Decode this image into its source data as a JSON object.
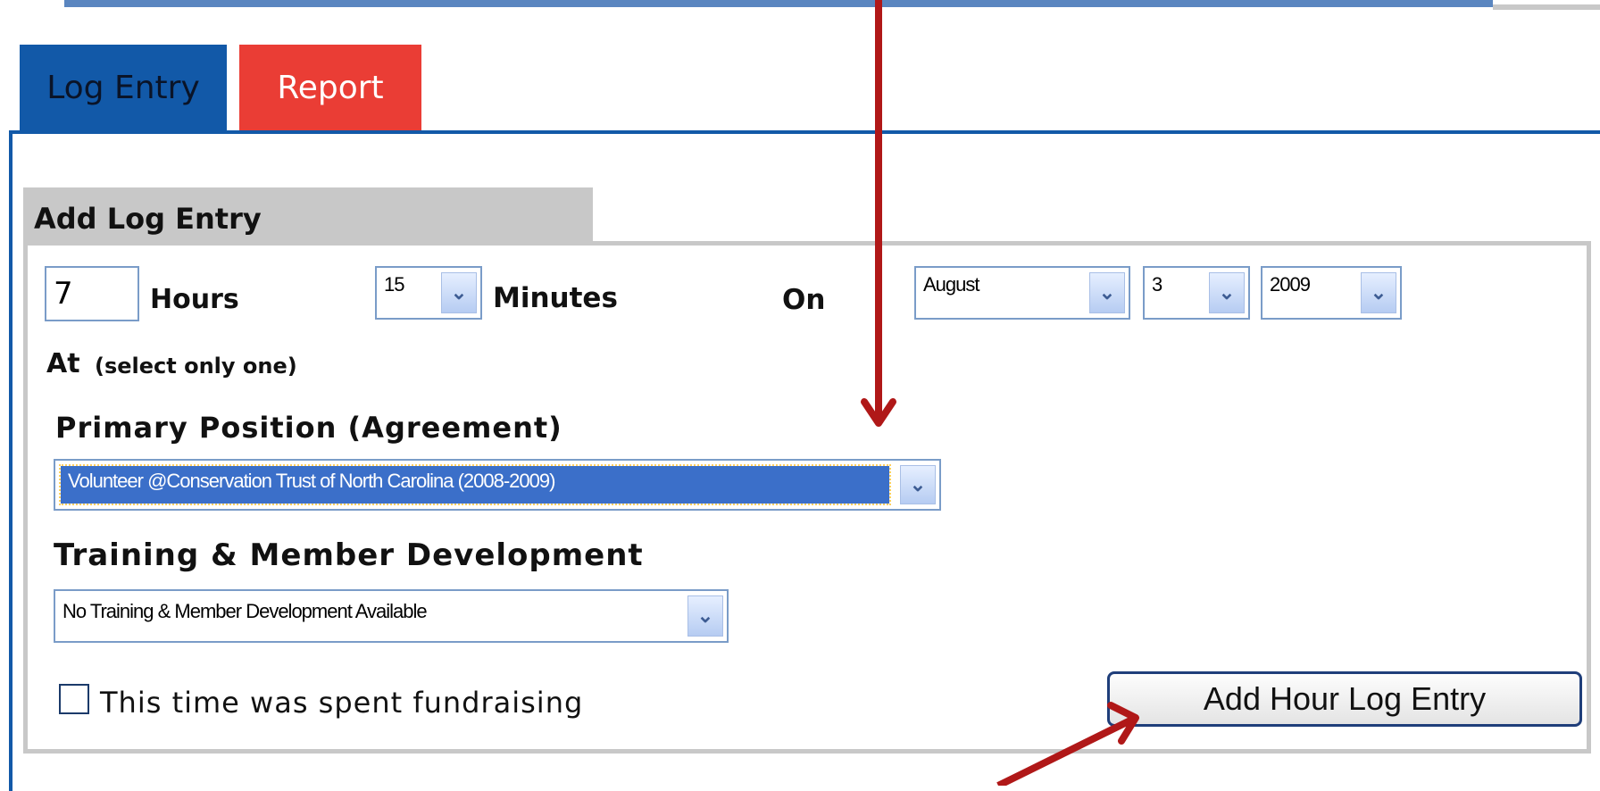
{
  "tabs": [
    {
      "label": "Log Entry"
    },
    {
      "label": "Report"
    }
  ],
  "section_title": "Add Log Entry",
  "hours": {
    "value": "7",
    "label": "Hours"
  },
  "minutes": {
    "value": "15",
    "label": "Minutes"
  },
  "on_label": "On",
  "date": {
    "month": "August",
    "day": "3",
    "year": "2009"
  },
  "at": {
    "label": "At",
    "hint": "(select only one)"
  },
  "primary_position": {
    "label": "Primary Position (Agreement)",
    "value": "Volunteer @Conservation Trust of North Carolina (2008-2009)"
  },
  "training": {
    "label": "Training & Member Development",
    "value": "No Training & Member Development Available"
  },
  "fundraising_checkbox": {
    "label": "This time was spent fundraising",
    "checked": false
  },
  "add_button_label": "Add Hour Log Entry",
  "colors": {
    "tab_active": "#1259a8",
    "tab_report": "#ea3d35",
    "arrow": "#b01818",
    "selected_option": "#3b6fc9"
  },
  "icons": {
    "dropdown": "chevron-down-icon"
  }
}
